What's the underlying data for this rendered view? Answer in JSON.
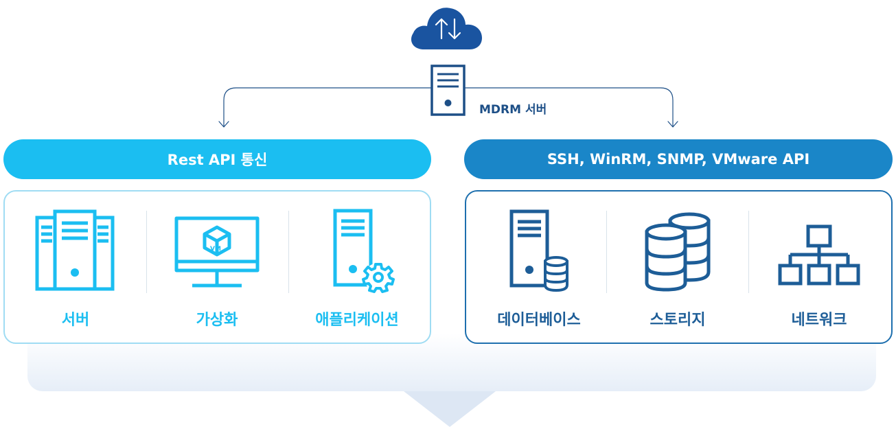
{
  "server": {
    "label": "MDRM 서버"
  },
  "groups": {
    "left": {
      "title": "Rest API 통신",
      "items": [
        {
          "label": "서버",
          "icon": "server-rack-icon"
        },
        {
          "label": "가상화",
          "icon": "vm-monitor-icon"
        },
        {
          "label": "애플리케이션",
          "icon": "app-server-gear-icon"
        }
      ]
    },
    "right": {
      "title": "SSH, WinRM, SNMP, VMware API",
      "items": [
        {
          "label": "데이터베이스",
          "icon": "db-server-icon"
        },
        {
          "label": "스토리지",
          "icon": "storage-icon"
        },
        {
          "label": "네트워크",
          "icon": "network-icon"
        }
      ]
    }
  },
  "colors": {
    "left_accent": "#1bbef1",
    "right_accent": "#1a86c8",
    "dark_blue": "#1d4f87",
    "cloud": "#1a54a0"
  }
}
